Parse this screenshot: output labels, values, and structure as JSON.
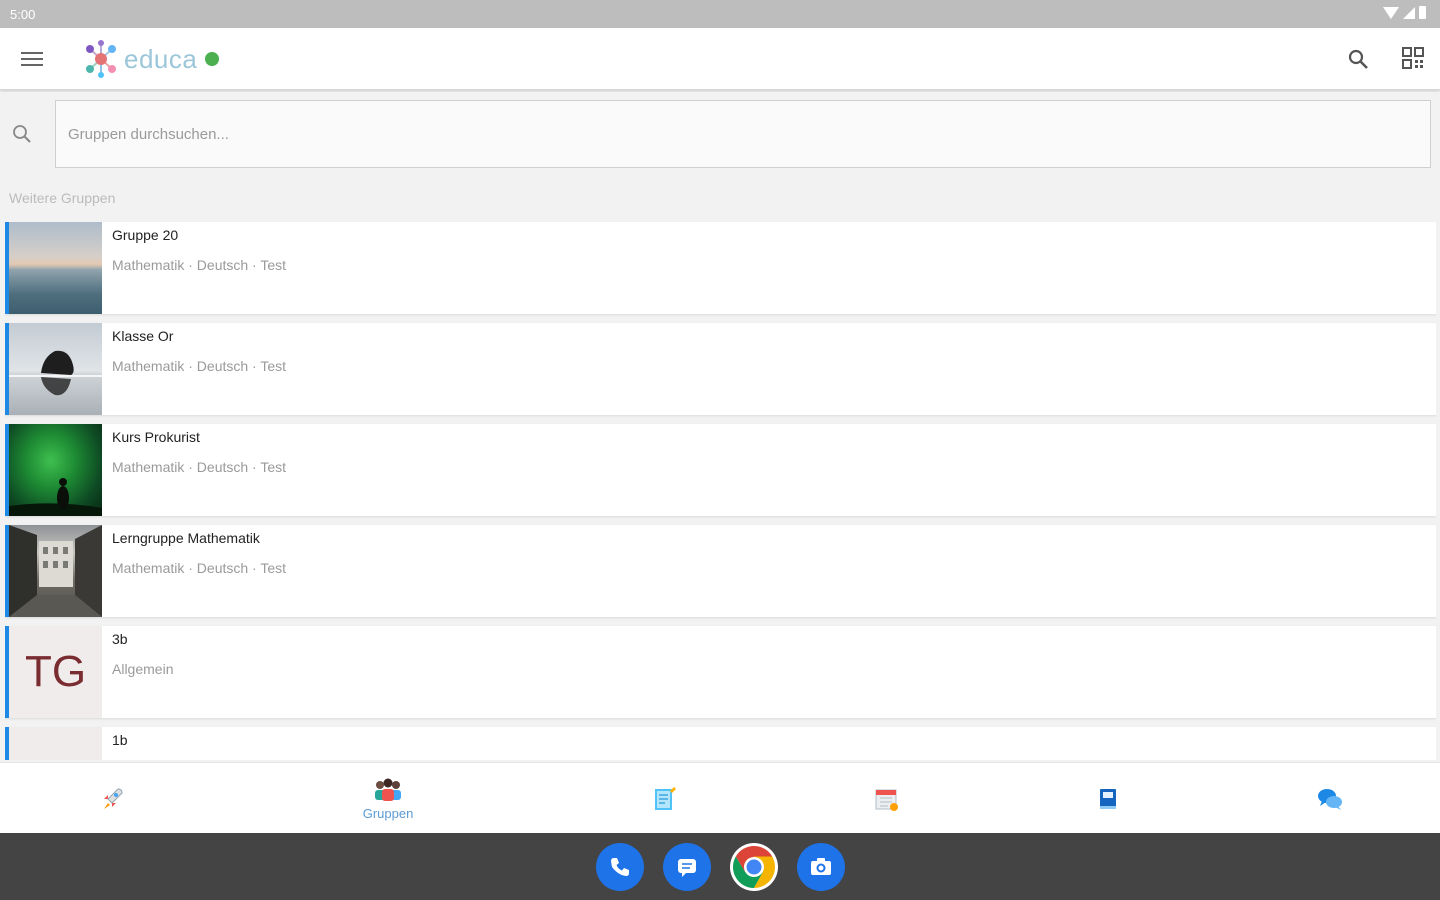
{
  "status_bar": {
    "time": "5:00"
  },
  "app_bar": {
    "brand": "educa",
    "online_color": "#4caf50",
    "icons": [
      "menu-icon",
      "search-icon",
      "qr-code-icon"
    ]
  },
  "search": {
    "placeholder": "Gruppen durchsuchen..."
  },
  "section_label": "Weitere Gruppen",
  "accent_color": "#1e88e5",
  "groups": [
    {
      "name": "Gruppe 20",
      "subjects": "Mathematik · Deutsch · Test",
      "thumbnail": "lake-sunset-image"
    },
    {
      "name": "Klasse Or",
      "subjects": "Mathematik · Deutsch · Test",
      "thumbnail": "rock-reflection-image"
    },
    {
      "name": "Kurs Prokurist",
      "subjects": "Mathematik · Deutsch · Test",
      "thumbnail": "aurora-image"
    },
    {
      "name": "Lerngruppe Mathematik",
      "subjects": "Mathematik · Deutsch · Test",
      "thumbnail": "street-image"
    },
    {
      "name": "3b",
      "subjects": "Allgemein",
      "thumbnail_text": "TG"
    },
    {
      "name": "1b",
      "subjects": "",
      "thumbnail_text": ""
    }
  ],
  "bottom_nav": {
    "items": [
      {
        "icon": "rocket-icon",
        "label": ""
      },
      {
        "icon": "people-icon",
        "label": "Gruppen"
      },
      {
        "icon": "notepad-icon",
        "label": ""
      },
      {
        "icon": "calendar-icon",
        "label": ""
      },
      {
        "icon": "book-icon",
        "label": ""
      },
      {
        "icon": "chat-icon",
        "label": ""
      }
    ],
    "active_color": "#5b9bd5"
  },
  "dock": [
    "phone-icon",
    "messages-icon",
    "chrome-icon",
    "camera-icon"
  ]
}
